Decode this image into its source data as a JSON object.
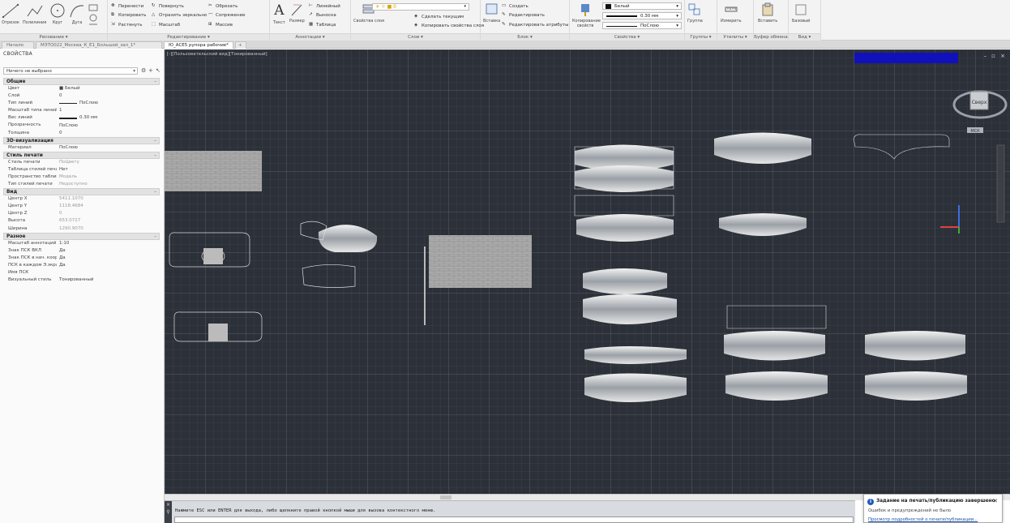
{
  "ribbon": {
    "panels": [
      {
        "title": "Рисование ▾",
        "tools": [
          "Отрезок",
          "Полилиния",
          "Круг",
          "Дуга"
        ]
      },
      {
        "title": "Редактирование ▾",
        "tools": [
          "Перенести",
          "Повернуть",
          "Обрезать",
          "Копировать",
          "Отразить зеркально",
          "Сопряжение",
          "Растянуть",
          "Масштаб",
          "Массив"
        ]
      },
      {
        "title": "Аннотации ▾",
        "tools": [
          "Текст",
          "Размер",
          "Линейный",
          "Выноска",
          "Таблица"
        ]
      },
      {
        "title": "Слои ▾",
        "tools": [
          "Свойства слоя",
          "Сделать текущим",
          "Копировать свойства слоя"
        ]
      },
      {
        "title": "Блок ▾",
        "tools": [
          "Вставка",
          "Создать",
          "Редактировать",
          "Редактировать атрибуты"
        ]
      },
      {
        "title": "Свойства ▾",
        "tools": [
          "Копирование свойств",
          "Белый",
          "0.30 мм",
          "ПоСлою"
        ]
      },
      {
        "title": "Группы ▾",
        "tools": [
          "Группа"
        ]
      },
      {
        "title": "Утилиты ▾",
        "tools": [
          "Измерить"
        ]
      },
      {
        "title": "Буфер обмена",
        "tools": [
          "Вставить"
        ]
      },
      {
        "title": "Вид ▾",
        "tools": [
          "Базовый"
        ]
      }
    ]
  },
  "file_tabs": [
    {
      "label": "Начало"
    },
    {
      "label": "МЭТО022_Москва_К_Е1_Большой_зал_1*"
    },
    {
      "label": "Ю_АСЕ5 рупора рабочие*"
    }
  ],
  "properties": {
    "title": "СВОЙСТВА",
    "selection": "Ничего не выбрано",
    "sections": [
      {
        "name": "Общие",
        "rows": [
          {
            "k": "Цвет",
            "v": "■ Белый"
          },
          {
            "k": "Слой",
            "v": "0"
          },
          {
            "k": "Тип линий",
            "v": "ПоСлою",
            "swatch": "thin"
          },
          {
            "k": "Масштаб типа линий",
            "v": "1"
          },
          {
            "k": "Вес линий",
            "v": "0.30 мм",
            "swatch": "thick"
          },
          {
            "k": "Прозрачность",
            "v": "ПоСлою"
          },
          {
            "k": "Толщина",
            "v": "0"
          }
        ]
      },
      {
        "name": "3D-визуализация",
        "rows": [
          {
            "k": "Материал",
            "v": "ПоСлою"
          }
        ]
      },
      {
        "name": "Стиль печати",
        "rows": [
          {
            "k": "Стиль печати",
            "v": "ПоЦвету",
            "dim": true
          },
          {
            "k": "Таблица стилей печати",
            "v": "Нет"
          },
          {
            "k": "Пространство таблицы сти...",
            "v": "Модель",
            "dim": true
          },
          {
            "k": "Тип стилей печати",
            "v": "Недоступно",
            "dim": true
          }
        ]
      },
      {
        "name": "Вид",
        "rows": [
          {
            "k": "Центр X",
            "v": "5411.1070",
            "dim": true
          },
          {
            "k": "Центр Y",
            "v": "1118.4684",
            "dim": true
          },
          {
            "k": "Центр Z",
            "v": "0",
            "dim": true
          },
          {
            "k": "Высота",
            "v": "653.0727",
            "dim": true
          },
          {
            "k": "Ширина",
            "v": "1290.9070",
            "dim": true
          }
        ]
      },
      {
        "name": "Разное",
        "rows": [
          {
            "k": "Масштаб аннотаций",
            "v": "1:10"
          },
          {
            "k": "Знак ПСК ВКЛ",
            "v": "Да"
          },
          {
            "k": "Знак ПСК в нач. коорд.",
            "v": "Да"
          },
          {
            "k": "ПСК в каждом Э.экране",
            "v": "Да"
          },
          {
            "k": "Имя ПСК",
            "v": ""
          },
          {
            "k": "Визуальный стиль",
            "v": "Тонированный"
          }
        ]
      }
    ]
  },
  "viewport": {
    "label": "[-][Пользовательский вид][Тонированный]",
    "window_controls": "– ▫ ×",
    "viewcube_face": "Сверх",
    "viewcube_wcs": "МСК"
  },
  "command": {
    "history": "Нажмите ESC или ENTER для выхода, либо щелкните правой кнопкой мыши для вызова контекстного меню.",
    "prompt": ""
  },
  "notification": {
    "title": "Задание на печать/публикацию завершено",
    "body": "Ошибок и предупреждений не было",
    "link": "Просмотр подробностей о печати/публикации..."
  },
  "colors": {
    "canvas": "#2b3039",
    "accent": "#1111bb",
    "link": "#1a4fa3"
  }
}
